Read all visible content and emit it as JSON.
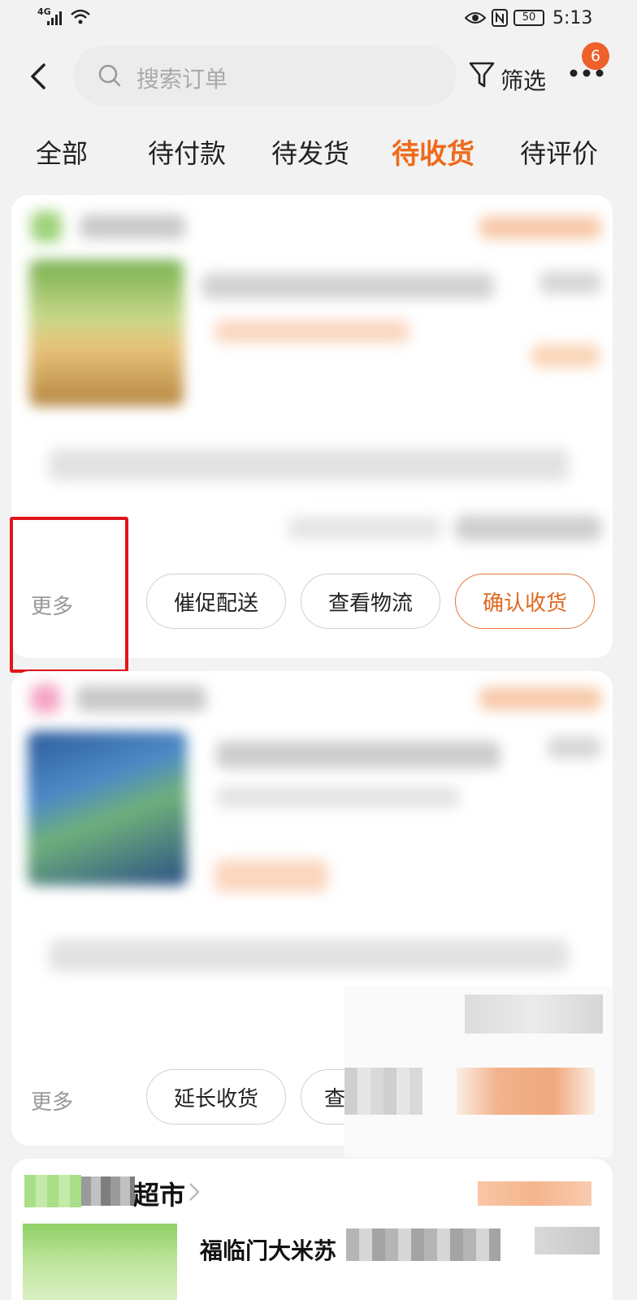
{
  "status_bar": {
    "network": "4G",
    "battery": "50",
    "time": "5:13"
  },
  "header": {
    "search_placeholder": "搜索订单",
    "filter_label": "筛选",
    "more_badge": "6"
  },
  "tabs": [
    {
      "label": "全部",
      "active": false
    },
    {
      "label": "待付款",
      "active": false
    },
    {
      "label": "待发货",
      "active": false
    },
    {
      "label": "待收货",
      "active": true
    },
    {
      "label": "待评价",
      "active": false
    }
  ],
  "orders": [
    {
      "more_label": "更多",
      "actions": [
        {
          "label": "催促配送",
          "primary": false
        },
        {
          "label": "查看物流",
          "primary": false
        },
        {
          "label": "确认收货",
          "primary": true
        }
      ]
    },
    {
      "more_label": "更多",
      "actions": [
        {
          "label": "延长收货",
          "primary": false
        },
        {
          "label": "查",
          "primary": false
        }
      ]
    },
    {
      "store_name_suffix": "超市",
      "product_title": "福临门大米苏"
    }
  ],
  "colors": {
    "accent": "#ef6a1c",
    "highlight_box": "#e0161a",
    "badge": "#f0602a"
  }
}
